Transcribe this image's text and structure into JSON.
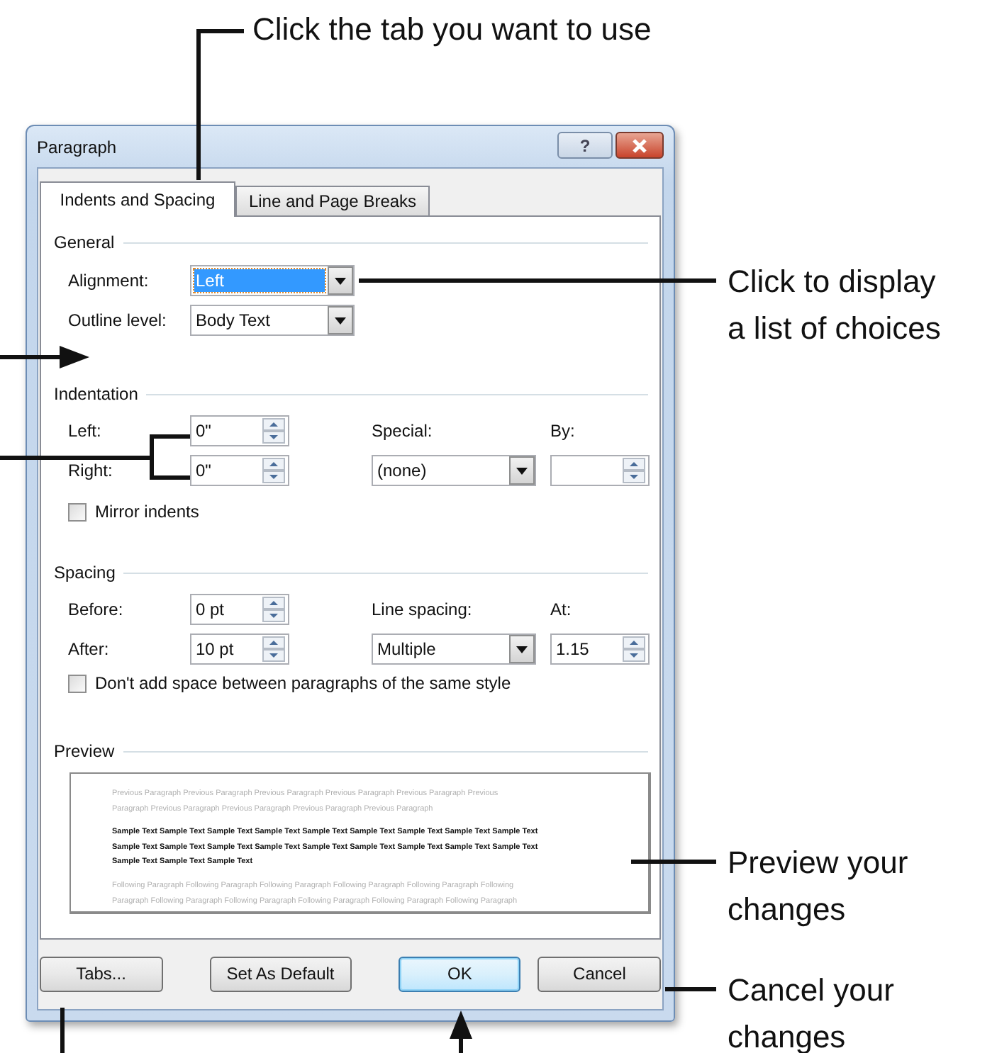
{
  "callouts": [
    {
      "lines": [
        "Click the tab you want to use"
      ]
    },
    {
      "lines": [
        "Click to display",
        "a list of choices"
      ]
    },
    {
      "lines": [
        "Preview your",
        "changes"
      ]
    },
    {
      "lines": [
        "Cancel your",
        "changes"
      ]
    }
  ],
  "dialog": {
    "title": "Paragraph",
    "help_button": "?",
    "tabs": [
      {
        "label": "Indents and Spacing",
        "selected": true
      },
      {
        "label": "Line and Page Breaks",
        "selected": false
      }
    ],
    "general": {
      "heading": "General",
      "alignment": {
        "label": "Alignment:",
        "value": "Left",
        "focused": true
      },
      "outline_level": {
        "label": "Outline level:",
        "value": "Body Text",
        "focused": false
      }
    },
    "indentation": {
      "heading": "Indentation",
      "left": {
        "label": "Left:",
        "value": "0\""
      },
      "right": {
        "label": "Right:",
        "value": "0\""
      },
      "special": {
        "label": "Special:",
        "value": "(none)"
      },
      "by": {
        "label": "By:"
      },
      "mirror_indents": {
        "label": "Mirror indents",
        "checked": false
      }
    },
    "spacing": {
      "heading": "Spacing",
      "before": {
        "label": "Before:",
        "value": "0 pt"
      },
      "after": {
        "label": "After:",
        "value": "10 pt"
      },
      "line_spacing": {
        "label": "Line spacing:",
        "value": "Multiple"
      },
      "at": {
        "label": "At:",
        "value": "1.15"
      },
      "dont_add_space": {
        "label": "Don't add space between paragraphs of the same style",
        "checked": false
      }
    },
    "preview": {
      "heading": "Preview",
      "previous_lines": [
        "Previous Paragraph Previous Paragraph Previous Paragraph Previous Paragraph Previous Paragraph Previous",
        "Paragraph Previous Paragraph Previous Paragraph Previous Paragraph Previous Paragraph"
      ],
      "sample_lines": [
        "Sample Text Sample Text Sample Text Sample Text Sample Text Sample Text Sample Text Sample Text Sample Text",
        "Sample Text Sample Text Sample Text Sample Text Sample Text Sample Text Sample Text Sample Text Sample Text",
        "Sample Text Sample Text Sample Text"
      ],
      "following_lines": [
        "Following Paragraph Following Paragraph Following Paragraph Following Paragraph Following Paragraph Following",
        "Paragraph Following Paragraph Following Paragraph Following Paragraph Following Paragraph Following Paragraph"
      ]
    },
    "buttons": [
      {
        "label": "Tabs...",
        "default": false
      },
      {
        "label": "Set As Default",
        "default": false
      },
      {
        "label": "OK",
        "default": true
      },
      {
        "label": "Cancel",
        "default": false
      }
    ]
  }
}
